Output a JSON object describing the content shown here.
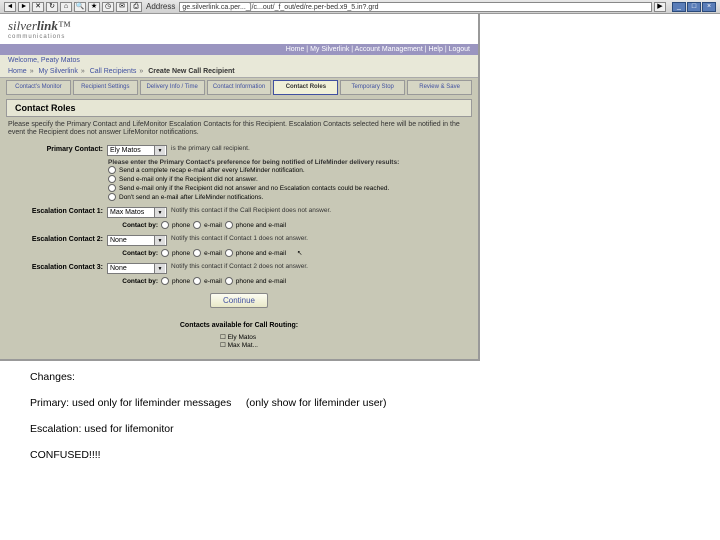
{
  "browser": {
    "addr_label": "Address",
    "addr_value": "ge.silverlink.ca.per..._]/c...out/_f_out/ed/re.per-bed.x9_5.in?.grd",
    "go_label": "▶"
  },
  "logo": {
    "part1": "silver",
    "part2": "link",
    "tm": "™",
    "sub": "communications"
  },
  "util_links": "Home | My Silverlink | Account Management | Help | Logout",
  "welcome": "Welcome, Peaty Matos",
  "breadcrumb": {
    "b1": "Home",
    "b2": "My Silverlink",
    "b3": "Call Recipients",
    "current": "Create New Call Recipient"
  },
  "tabs": {
    "t1": "Contact's Monitor",
    "t2": "Recipient Settings",
    "t3": "Delivery Info / Time",
    "t4": "Contact Information",
    "t5": "Contact Roles",
    "t6": "Temporary Stop",
    "t7": "Review & Save"
  },
  "section_title": "Contact Roles",
  "instructions": "Please specify the Primary Contact and LifeMonitor Escalation Contacts for this Recipient. Escalation Contacts selected here will be notified in the event the Recipient does not answer LifeMonitor notifications.",
  "primary": {
    "label": "Primary Contact:",
    "value": "Ely Matos",
    "hint": "is the primary call recipient.",
    "prompt": "Please enter the Primary Contact's preference for being notified of LifeMinder delivery results:",
    "opt1": "Send a complete recap e-mail after every LifeMinder notification.",
    "opt2": "Send e-mail only if the Recipient did not answer.",
    "opt3": "Send e-mail only if the Recipient did not answer and no Escalation contacts could be reached.",
    "opt4": "Don't send an e-mail after LifeMinder notifications."
  },
  "esc1": {
    "label": "Escalation Contact 1:",
    "value": "Max Matos",
    "hint": "Notify this contact if the Call Recipient does not answer.",
    "contact_by_label": "Contact by:",
    "cb1": "phone",
    "cb2": "e-mail",
    "cb3": "phone and e-mail"
  },
  "esc2": {
    "label": "Escalation Contact 2:",
    "value": "None",
    "hint": "Notify this contact if Contact 1 does not answer.",
    "contact_by_label": "Contact by:",
    "cb1": "phone",
    "cb2": "e-mail",
    "cb3": "phone and e-mail"
  },
  "esc3": {
    "label": "Escalation Contact 3:",
    "value": "None",
    "hint": "Notify this contact if Contact 2 does not answer.",
    "contact_by_label": "Contact by:",
    "cb1": "phone",
    "cb2": "e-mail",
    "cb3": "phone and e-mail"
  },
  "continue_label": "Continue",
  "avail": {
    "title": "Contacts available for Call Routing:",
    "item1": "Ely Matos",
    "item2": "Max Mat..."
  },
  "notes": {
    "n1": "Changes:",
    "n2a": "Primary: used only for lifeminder messages",
    "n2b": "(only show for lifeminder user)",
    "n3": "Escalation: used for lifemonitor",
    "n4": "CONFUSED!!!!"
  }
}
